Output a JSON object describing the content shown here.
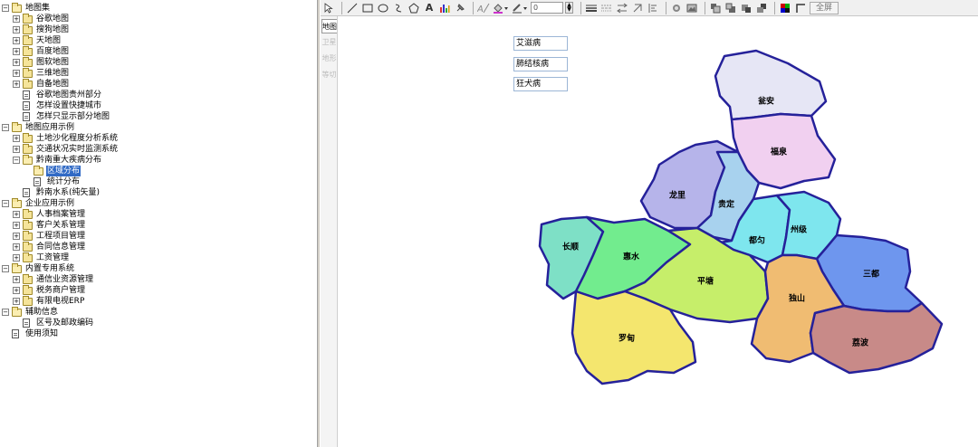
{
  "tree": [
    {
      "label": "地图集",
      "level": 0,
      "type": "folder-open",
      "expander": "-"
    },
    {
      "label": "谷歌地图",
      "level": 1,
      "type": "folder",
      "expander": "+"
    },
    {
      "label": "搜狗地图",
      "level": 1,
      "type": "folder",
      "expander": "+"
    },
    {
      "label": "天地图",
      "level": 1,
      "type": "folder",
      "expander": "+"
    },
    {
      "label": "百度地图",
      "level": 1,
      "type": "folder",
      "expander": "+"
    },
    {
      "label": "图软地图",
      "level": 1,
      "type": "folder",
      "expander": "+"
    },
    {
      "label": "三维地图",
      "level": 1,
      "type": "folder",
      "expander": "+"
    },
    {
      "label": "自备地图",
      "level": 1,
      "type": "folder",
      "expander": "+"
    },
    {
      "label": "谷歌地图贵州部分",
      "level": 1,
      "type": "doc",
      "expander": ""
    },
    {
      "label": "怎样设置快捷城市",
      "level": 1,
      "type": "doc",
      "expander": ""
    },
    {
      "label": "怎样只显示部分地图",
      "level": 1,
      "type": "doc",
      "expander": ""
    },
    {
      "label": "地图应用示例",
      "level": 0,
      "type": "folder-open",
      "expander": "-"
    },
    {
      "label": "土地沙化程度分析系统",
      "level": 1,
      "type": "folder",
      "expander": "+"
    },
    {
      "label": "交通状况实时监测系统",
      "level": 1,
      "type": "folder",
      "expander": "+"
    },
    {
      "label": "黔南重大疾病分布",
      "level": 1,
      "type": "folder-open",
      "expander": "-"
    },
    {
      "label": "区域分布",
      "level": 2,
      "type": "folder-open",
      "expander": "",
      "selected": true
    },
    {
      "label": "统计分布",
      "level": 2,
      "type": "doc",
      "expander": ""
    },
    {
      "label": "黔南水系(纯矢量)",
      "level": 1,
      "type": "doc",
      "expander": ""
    },
    {
      "label": "企业应用示例",
      "level": 0,
      "type": "folder-open",
      "expander": "-"
    },
    {
      "label": "人事档案管理",
      "level": 1,
      "type": "folder",
      "expander": "+"
    },
    {
      "label": "客户关系管理",
      "level": 1,
      "type": "folder",
      "expander": "+"
    },
    {
      "label": "工程项目管理",
      "level": 1,
      "type": "folder",
      "expander": "+"
    },
    {
      "label": "合同信息管理",
      "level": 1,
      "type": "folder",
      "expander": "+"
    },
    {
      "label": "工资管理",
      "level": 1,
      "type": "folder",
      "expander": "+"
    },
    {
      "label": "内置专用系统",
      "level": 0,
      "type": "folder-open",
      "expander": "-"
    },
    {
      "label": "通信业资源管理",
      "level": 1,
      "type": "folder",
      "expander": "+"
    },
    {
      "label": "税务商户管理",
      "level": 1,
      "type": "folder",
      "expander": "+"
    },
    {
      "label": "有限电视ERP",
      "level": 1,
      "type": "folder",
      "expander": "+"
    },
    {
      "label": "辅助信息",
      "level": 0,
      "type": "folder-open",
      "expander": "-"
    },
    {
      "label": "区号及邮政编码",
      "level": 1,
      "type": "doc",
      "expander": ""
    },
    {
      "label": "使用须知",
      "level": 0,
      "type": "doc",
      "expander": ""
    }
  ],
  "toolbar": {
    "text_tool": "A",
    "width_value": "0",
    "fullscreen_label": "全屏"
  },
  "side_tabs": [
    "地图",
    "卫星",
    "地形",
    "等切"
  ],
  "legend": [
    "艾滋病",
    "肺结核病",
    "狂犬病"
  ],
  "regions": [
    {
      "name": "瓮安",
      "color": "#e6e6f5"
    },
    {
      "name": "福泉",
      "color": "#f1d0f0"
    },
    {
      "name": "龙里",
      "color": "#b6b4ea"
    },
    {
      "name": "贵定",
      "color": "#a8d2ee"
    },
    {
      "name": "都匀",
      "color": "#7ee6ee"
    },
    {
      "name": "州级",
      "color": "#7ee6ee"
    },
    {
      "name": "长顺",
      "color": "#7ee0c6"
    },
    {
      "name": "惠水",
      "color": "#72ec8e"
    },
    {
      "name": "平塘",
      "color": "#c6ee6a"
    },
    {
      "name": "三都",
      "color": "#6e96ee"
    },
    {
      "name": "独山",
      "color": "#f0bc72"
    },
    {
      "name": "荔波",
      "color": "#c88a88"
    },
    {
      "name": "罗甸",
      "color": "#f4e66e"
    }
  ]
}
